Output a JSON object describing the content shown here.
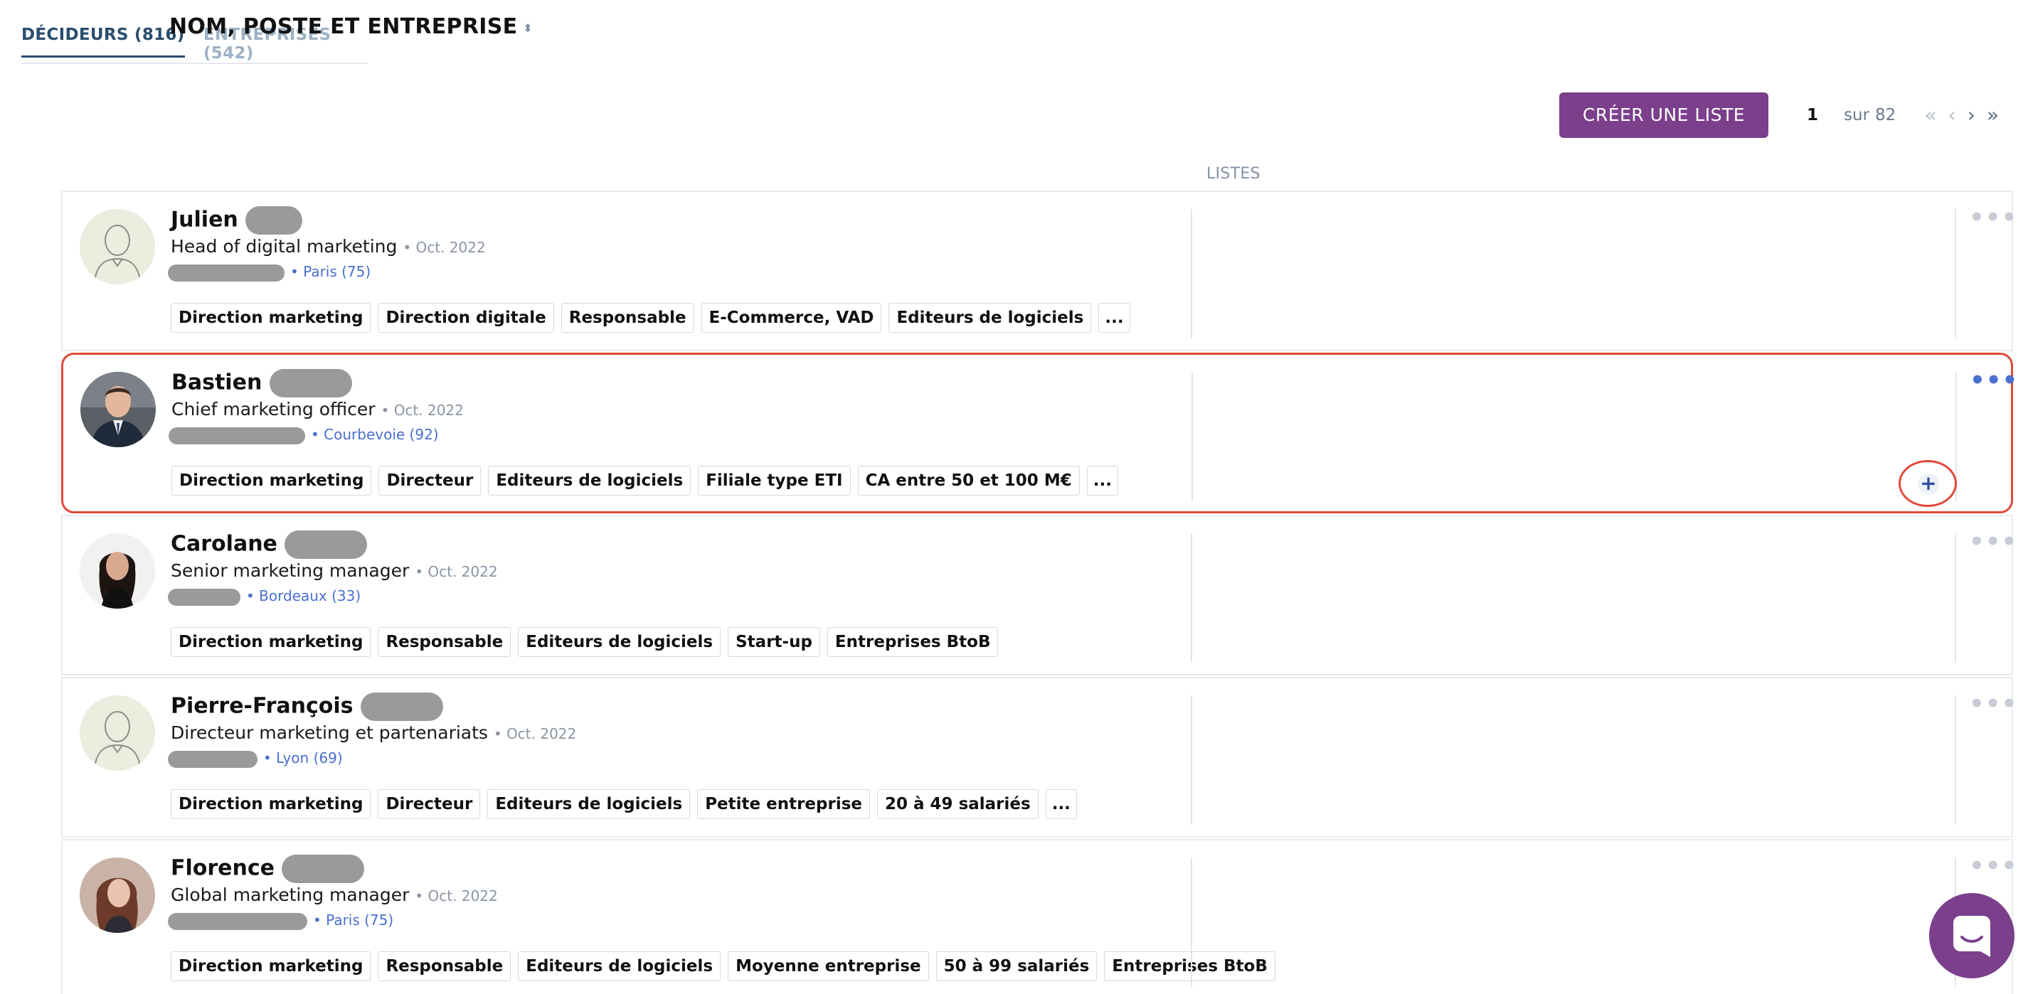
{
  "tabs": [
    {
      "label": "DÉCIDEURS (816)",
      "active": true
    },
    {
      "label": "ENTREPRISES (542)",
      "active": false
    }
  ],
  "toolbar": {
    "create_label": "CRÉER UNE LISTE"
  },
  "pager": {
    "current": "1",
    "sur": "sur",
    "total": "82"
  },
  "columns": {
    "name": "NOM, POSTE ET ENTREPRISE",
    "lists": "LISTES"
  },
  "rows": [
    {
      "first": "Julien",
      "role": "Head of digital marketing",
      "date": "Oct. 2022",
      "location": "Paris (75)",
      "tags": [
        "Direction marketing",
        "Direction digitale",
        "Responsable",
        "E-Commerce, VAD",
        "Editeurs de logiciels"
      ],
      "more": "..."
    },
    {
      "first": "Bastien",
      "role": "Chief marketing officer",
      "date": "Oct. 2022",
      "location": "Courbevoie (92)",
      "tags": [
        "Direction marketing",
        "Directeur",
        "Editeurs de logiciels",
        "Filiale type ETI",
        "CA entre 50 et 100 M€"
      ],
      "more": "..."
    },
    {
      "first": "Carolane",
      "role": "Senior marketing manager",
      "date": "Oct. 2022",
      "location": "Bordeaux (33)",
      "tags": [
        "Direction marketing",
        "Responsable",
        "Editeurs de logiciels",
        "Start-up",
        "Entreprises BtoB"
      ],
      "more": ""
    },
    {
      "first": "Pierre-François",
      "role": "Directeur marketing et partenariats",
      "date": "Oct. 2022",
      "location": "Lyon (69)",
      "tags": [
        "Direction marketing",
        "Directeur",
        "Editeurs de logiciels",
        "Petite entreprise",
        "20 à 49 salariés"
      ],
      "more": "..."
    },
    {
      "first": "Florence",
      "role": "Global marketing manager",
      "date": "Oct. 2022",
      "location": "Paris (75)",
      "tags": [
        "Direction marketing",
        "Responsable",
        "Editeurs de logiciels",
        "Moyenne entreprise",
        "50 à 99 salariés",
        "Entreprises BtoB"
      ],
      "more": ""
    }
  ],
  "actions": {
    "dots": "•••",
    "add": "+"
  },
  "icons": {
    "sort": "sort-icon",
    "chat": "chat-icon",
    "add": "plus-icon",
    "more": "more-dots-icon"
  },
  "colors": {
    "accent": "#7b3f8b",
    "link": "#4a6fcf",
    "highlight": "#e04a3a"
  }
}
